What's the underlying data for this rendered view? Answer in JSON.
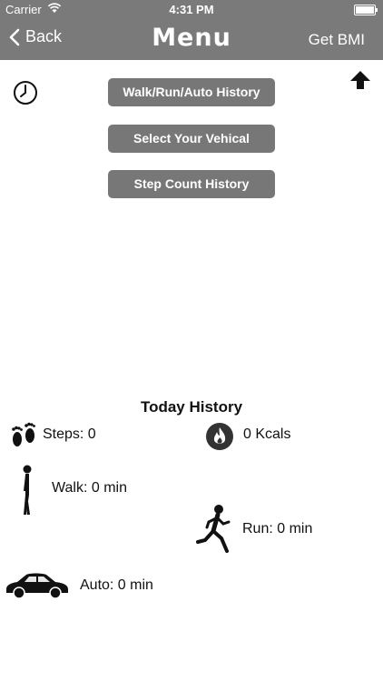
{
  "status_bar": {
    "carrier": "Carrier",
    "time": "4:31 PM"
  },
  "nav": {
    "back_label": "Back",
    "title": "Menu",
    "right_label": "Get BMI"
  },
  "menu": {
    "buttons": [
      {
        "label": "Walk/Run/Auto History"
      },
      {
        "label": "Select Your Vehical"
      },
      {
        "label": "Step Count History"
      }
    ]
  },
  "today": {
    "title": "Today History",
    "steps": "Steps: 0",
    "kcals": "0 Kcals",
    "walk": "Walk: 0 min",
    "run": "Run: 0 min",
    "auto": "Auto: 0 min"
  },
  "icons": {
    "clock": "clock-icon",
    "arrow": "arrow-up-icon",
    "steps": "footprints-icon",
    "kcals": "flame-icon",
    "walk": "walking-person-icon",
    "run": "running-person-icon",
    "auto": "car-icon"
  },
  "colors": {
    "nav_bg": "#7a7a7a",
    "button_bg": "#777777"
  }
}
